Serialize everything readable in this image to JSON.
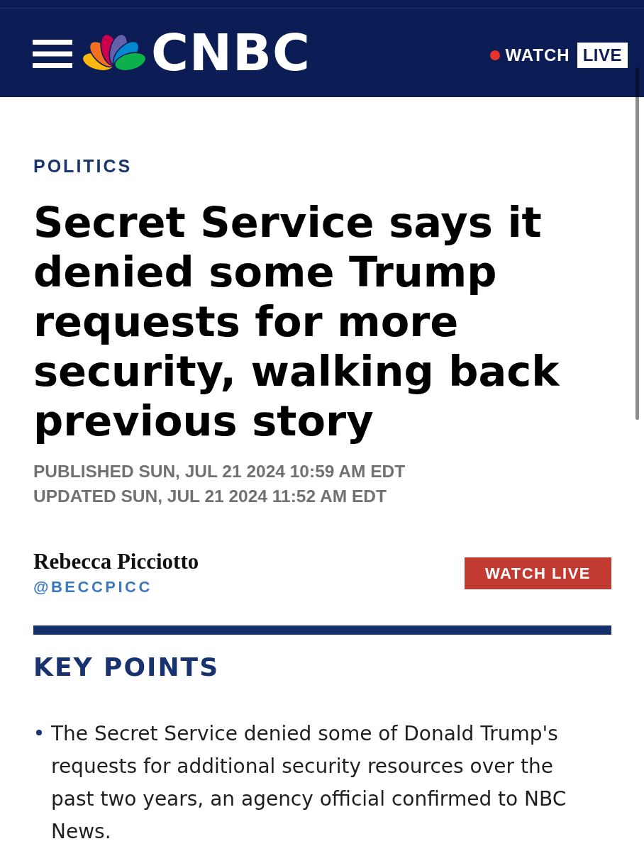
{
  "header": {
    "brand": "CNBC",
    "watch_label": "WATCH",
    "live_label": "LIVE"
  },
  "article": {
    "section": "POLITICS",
    "headline": "Secret Service says it denied some Trump requests for more security, walking back previous story",
    "published": "PUBLISHED SUN, JUL 21 2024 10:59 AM EDT",
    "updated": "UPDATED SUN, JUL 21 2024 11:52 AM EDT",
    "author": {
      "name": "Rebecca Picciotto",
      "handle": "@BECCPICC"
    },
    "watch_live_button": "WATCH LIVE"
  },
  "key_points": {
    "title": "KEY POINTS",
    "items": [
      "The Secret Service denied some of Donald Trump's requests for additional security resources over the past two years, an agency official confirmed to NBC News."
    ]
  }
}
